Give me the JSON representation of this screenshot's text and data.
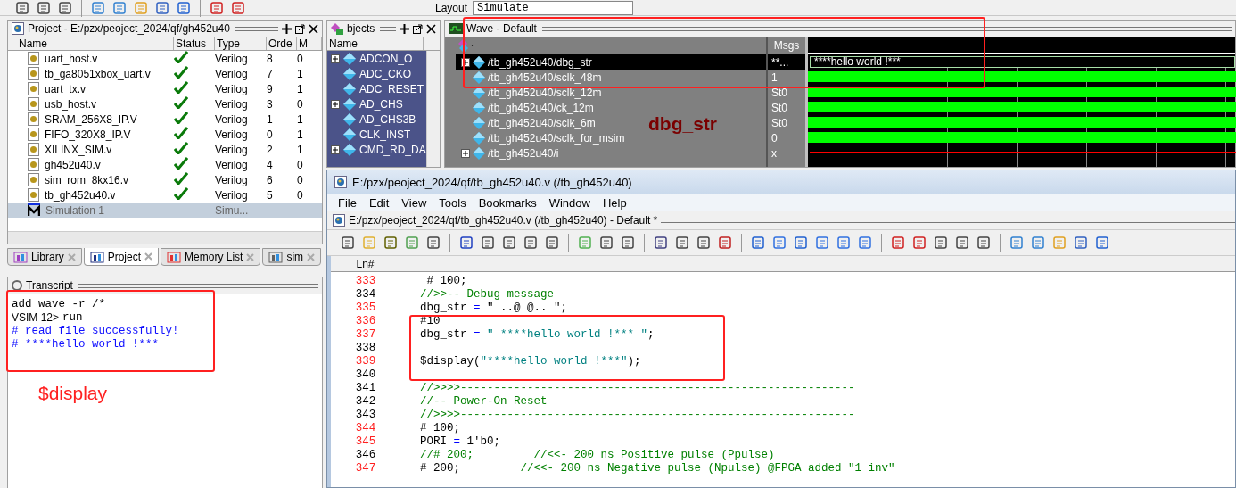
{
  "top_toolbar": {
    "layout_label": "Layout",
    "layout_value": "Simulate"
  },
  "project_panel": {
    "title": "Project - E:/pzx/peoject_2024/qf/gh452u40",
    "columns": [
      "Name",
      "Status",
      "Type",
      "Orde",
      "M"
    ],
    "rows": [
      {
        "kind": "file",
        "name": "uart_host.v",
        "checked": true,
        "type": "Verilog",
        "order": "8",
        "column_5": "0",
        "selected": false
      },
      {
        "kind": "file",
        "name": "tb_ga8051xbox_uart.v",
        "checked": true,
        "type": "Verilog",
        "order": "7",
        "column_5": "1",
        "selected": false
      },
      {
        "kind": "file",
        "name": "uart_tx.v",
        "checked": true,
        "type": "Verilog",
        "order": "9",
        "column_5": "1",
        "selected": false
      },
      {
        "kind": "file",
        "name": "usb_host.v",
        "checked": true,
        "type": "Verilog",
        "order": "3",
        "column_5": "0",
        "selected": false
      },
      {
        "kind": "file",
        "name": "SRAM_256X8_IP.V",
        "checked": true,
        "type": "Verilog",
        "order": "1",
        "column_5": "1",
        "selected": false
      },
      {
        "kind": "file",
        "name": "FIFO_320X8_IP.V",
        "checked": true,
        "type": "Verilog",
        "order": "0",
        "column_5": "1",
        "selected": false
      },
      {
        "kind": "file",
        "name": "XILINX_SIM.v",
        "checked": true,
        "type": "Verilog",
        "order": "2",
        "column_5": "1",
        "selected": false
      },
      {
        "kind": "file",
        "name": "gh452u40.v",
        "checked": true,
        "type": "Verilog",
        "order": "4",
        "column_5": "0",
        "selected": false
      },
      {
        "kind": "file",
        "name": "sim_rom_8kx16.v",
        "checked": true,
        "type": "Verilog",
        "order": "6",
        "column_5": "0",
        "selected": false
      },
      {
        "kind": "file",
        "name": "tb_gh452u40.v",
        "checked": true,
        "type": "Verilog",
        "order": "5",
        "column_5": "0",
        "selected": false
      },
      {
        "kind": "simulation",
        "name": "Simulation 1",
        "checked": false,
        "type": "Simu...",
        "selected": true
      }
    ]
  },
  "bottom_tabs": [
    {
      "label": "Library",
      "selected": false
    },
    {
      "label": "Project",
      "selected": true
    },
    {
      "label": "Memory List",
      "selected": false
    },
    {
      "label": "sim",
      "selected": false
    }
  ],
  "transcript": {
    "title": "Transcript",
    "annotation": "$display",
    "lines": [
      {
        "kind": "command",
        "text": "add wave -r /*"
      },
      {
        "kind": "command",
        "prompt": "VSIM 12>",
        "text": "run"
      },
      {
        "kind": "output",
        "text": "# read file successfully!"
      },
      {
        "kind": "output",
        "text": "# ****hello world !***"
      }
    ]
  },
  "objects_panel": {
    "title": "bjects",
    "column": "Name",
    "rows": [
      {
        "name": "ADCON_O",
        "expandable": true,
        "selected": true
      },
      {
        "name": "ADC_CKO",
        "expandable": false,
        "selected": true
      },
      {
        "name": "ADC_RESET",
        "expandable": false,
        "selected": true
      },
      {
        "name": "AD_CHS",
        "expandable": true,
        "selected": true
      },
      {
        "name": "AD_CHS3B",
        "expandable": false,
        "selected": true
      },
      {
        "name": "CLK_INST",
        "expandable": false,
        "selected": true
      },
      {
        "name": "CMD_RD_DA",
        "expandable": true,
        "selected": true
      }
    ]
  },
  "wave_panel": {
    "title": "Wave - Default",
    "msgs_header": "Msgs",
    "annotation": "dbg_str",
    "rows": [
      {
        "name": "/tb_gh452u40/dbg_str",
        "msg": "**...",
        "expandable": true,
        "selected": true,
        "kind": "string",
        "value": "****hello world !***"
      },
      {
        "name": "/tb_gh452u40/sclk_48m",
        "msg": "1",
        "expandable": false,
        "selected": false,
        "kind": "clock"
      },
      {
        "name": "/tb_gh452u40/sclk_12m",
        "msg": "St0",
        "expandable": false,
        "selected": false,
        "kind": "clock"
      },
      {
        "name": "/tb_gh452u40/ck_12m",
        "msg": "St0",
        "expandable": false,
        "selected": false,
        "kind": "clock"
      },
      {
        "name": "/tb_gh452u40/sclk_6m",
        "msg": "St0",
        "expandable": false,
        "selected": false,
        "kind": "clock"
      },
      {
        "name": "/tb_gh452u40/sclk_for_msim",
        "msg": "0",
        "expandable": false,
        "selected": false,
        "kind": "low"
      },
      {
        "name": "/tb_gh452u40/i",
        "msg": "x",
        "expandable": true,
        "selected": false,
        "kind": "unknown"
      }
    ]
  },
  "editor_window": {
    "title": "E:/pzx/peoject_2024/qf/tb_gh452u40.v (/tb_gh452u40)",
    "menu": [
      "File",
      "Edit",
      "View",
      "Tools",
      "Bookmarks",
      "Window",
      "Help"
    ],
    "doc_title": "E:/pzx/peoject_2024/qf/tb_gh452u40.v (/tb_gh452u40) - Default *",
    "line_header": "Ln#",
    "lines": [
      {
        "number": "333",
        "executable": true,
        "tokens": [
          {
            "kind": "code",
            "text": " # 100;"
          }
        ]
      },
      {
        "number": "334",
        "executable": false,
        "tokens": [
          {
            "kind": "comment",
            "text": "//>>-- Debug message"
          }
        ]
      },
      {
        "number": "335",
        "executable": true,
        "tokens": [
          {
            "kind": "code",
            "text": "dbg_str"
          },
          {
            "kind": "op",
            "text": " = "
          },
          {
            "kind": "code",
            "text": "\" ..@ @.. \";"
          }
        ]
      },
      {
        "number": "336",
        "executable": true,
        "tokens": [
          {
            "kind": "code",
            "text": "#10"
          }
        ]
      },
      {
        "number": "337",
        "executable": true,
        "tokens": [
          {
            "kind": "code",
            "text": "dbg_str"
          },
          {
            "kind": "op",
            "text": " = "
          },
          {
            "kind": "string",
            "text": "\" ****hello world !*** \""
          },
          {
            "kind": "code",
            "text": ";"
          }
        ]
      },
      {
        "number": "338",
        "executable": false
      },
      {
        "number": "339",
        "executable": true,
        "tokens": [
          {
            "kind": "code",
            "text": "$display("
          },
          {
            "kind": "string",
            "text": "\"****hello world !***\""
          },
          {
            "kind": "code",
            "text": ");"
          }
        ]
      },
      {
        "number": "340",
        "executable": false
      },
      {
        "number": "341",
        "executable": false,
        "tokens": [
          {
            "kind": "comment",
            "text": "//>>>>-----------------------------------------------------------"
          }
        ]
      },
      {
        "number": "342",
        "executable": false,
        "tokens": [
          {
            "kind": "comment",
            "text": "//-- Power-On Reset"
          }
        ]
      },
      {
        "number": "343",
        "executable": false,
        "tokens": [
          {
            "kind": "comment",
            "text": "//>>>>-----------------------------------------------------------"
          }
        ]
      },
      {
        "number": "344",
        "executable": true,
        "tokens": [
          {
            "kind": "code",
            "text": "# 100;"
          }
        ]
      },
      {
        "number": "345",
        "executable": true,
        "tokens": [
          {
            "kind": "code",
            "text": "PORI"
          },
          {
            "kind": "op",
            "text": " = "
          },
          {
            "kind": "code",
            "text": "1'b0;"
          }
        ]
      },
      {
        "number": "346",
        "executable": false,
        "tokens": [
          {
            "kind": "comment",
            "text": "//# 200;         //<<- 200 ns Positive pulse (Ppulse)"
          }
        ]
      },
      {
        "number": "347",
        "executable": true,
        "tokens": [
          {
            "kind": "code",
            "text": "# 200;         "
          },
          {
            "kind": "comment",
            "text": "//<<- 200 ns Negative pulse (Npulse) @FPGA added \"1 inv\""
          }
        ]
      }
    ]
  }
}
